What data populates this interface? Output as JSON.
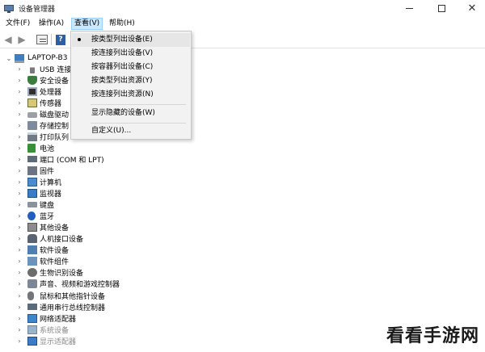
{
  "window": {
    "title": "设备管理器",
    "minimize_icon": "minimize-icon",
    "maximize_icon": "maximize-icon",
    "close_icon": "close-icon",
    "close_glyph": "✕"
  },
  "menubar": {
    "items": [
      "文件(F)",
      "操作(A)",
      "查看(V)",
      "帮助(H)"
    ],
    "active_index": 2
  },
  "toolbar": {
    "back_glyph": "◀",
    "forward_glyph": "▶",
    "help_glyph": "?"
  },
  "view_menu": {
    "items": [
      {
        "label": "按类型列出设备(E)",
        "checked": true
      },
      {
        "label": "按连接列出设备(V)",
        "checked": false
      },
      {
        "label": "按容器列出设备(C)",
        "checked": false
      },
      {
        "label": "按类型列出资源(Y)",
        "checked": false
      },
      {
        "label": "按连接列出资源(N)",
        "checked": false
      },
      {
        "label": "显示隐藏的设备(W)",
        "checked": false
      },
      {
        "label": "自定义(U)...",
        "checked": false
      }
    ]
  },
  "tree": {
    "root": {
      "label": "LAPTOP-B3",
      "expander": "⌄",
      "icon": "laptop-icon"
    },
    "expander_collapsed": "›",
    "items": [
      {
        "label": "USB 连接",
        "icon": "usb-icon"
      },
      {
        "label": "安全设备",
        "icon": "shield-icon"
      },
      {
        "label": "处理器",
        "icon": "cpu-icon"
      },
      {
        "label": "传感器",
        "icon": "sensor-icon"
      },
      {
        "label": "磁盘驱动",
        "icon": "disk-icon"
      },
      {
        "label": "存储控制",
        "icon": "storage-icon"
      },
      {
        "label": "打印队列",
        "icon": "printer-icon"
      },
      {
        "label": "电池",
        "icon": "battery-icon"
      },
      {
        "label": "端口 (COM 和 LPT)",
        "icon": "port-icon"
      },
      {
        "label": "固件",
        "icon": "firmware-icon"
      },
      {
        "label": "计算机",
        "icon": "computer-icon"
      },
      {
        "label": "监视器",
        "icon": "monitor-icon"
      },
      {
        "label": "键盘",
        "icon": "keyboard-icon"
      },
      {
        "label": "蓝牙",
        "icon": "bluetooth-icon"
      },
      {
        "label": "其他设备",
        "icon": "other-device-icon"
      },
      {
        "label": "人机接口设备",
        "icon": "hid-icon"
      },
      {
        "label": "软件设备",
        "icon": "software-device-icon"
      },
      {
        "label": "软件组件",
        "icon": "software-component-icon"
      },
      {
        "label": "生物识别设备",
        "icon": "biometric-icon"
      },
      {
        "label": "声音、视频和游戏控制器",
        "icon": "audio-icon"
      },
      {
        "label": "鼠标和其他指针设备",
        "icon": "mouse-icon"
      },
      {
        "label": "通用串行总线控制器",
        "icon": "usb-controller-icon"
      },
      {
        "label": "网络适配器",
        "icon": "network-adapter-icon"
      },
      {
        "label": "系统设备",
        "icon": "system-device-icon",
        "dim": true
      },
      {
        "label": "显示适配器",
        "icon": "display-adapter-icon",
        "dim": true
      }
    ]
  },
  "watermark": "看看手游网"
}
